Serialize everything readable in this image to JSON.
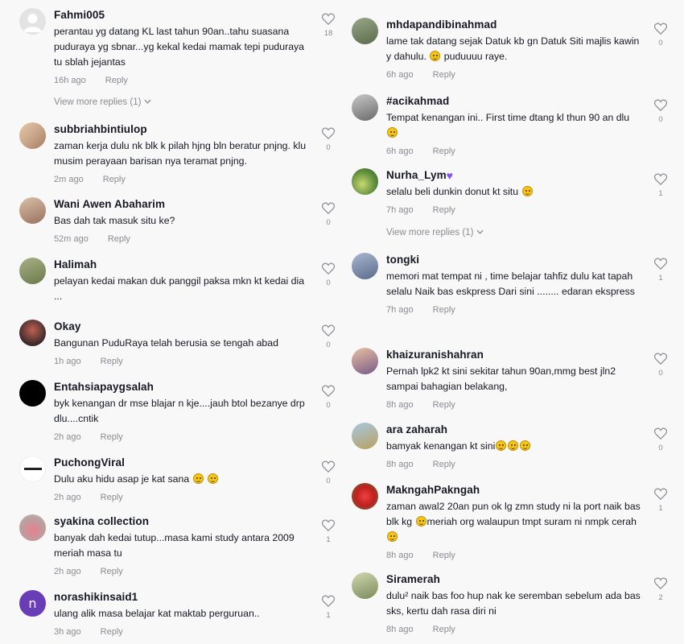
{
  "reply_label": "Reply",
  "left": [
    {
      "user": "Fahmi005",
      "text": "perantau yg datang KL last tahun 90an..tahu suasana puduraya yg sbnar...yg kekal kedai mamak tepi puduraya tu sblah jejantas",
      "time": "16h ago",
      "likes": "18",
      "avatar_color": "#d9d9d9",
      "avatar": "default-avatar",
      "view_more": "View more replies (1)"
    },
    {
      "user": "subbriahbintiulop",
      "text": "zaman kerja dulu nk blk k pilah hjng bln beratur pnjng. klu musim perayaan barisan nya teramat pnjng.",
      "time": "2m ago",
      "likes": "0",
      "avatar_color": "#c9a78a",
      "avatar": "photo-avatar"
    },
    {
      "user": "Wani Awen Abaharim",
      "text": "Bas dah tak masuk situ ke?",
      "time": "52m ago",
      "likes": "0",
      "avatar_color": "#b58a6e",
      "avatar": "photo-avatar"
    },
    {
      "user": "Halimah",
      "text": "pelayan kedai makan duk panggil paksa mkn kt kedai dia ...",
      "time": "",
      "likes": "0",
      "avatar_color": "#7a8a5a",
      "avatar": "photo-avatar"
    },
    {
      "user": "Okay",
      "text": "Bangunan PuduRaya telah berusia se tengah abad",
      "time": "1h ago",
      "likes": "0",
      "avatar_color": "#3a2a2a",
      "avatar": "photo-avatar"
    },
    {
      "user": "Entahsiapaygsalah",
      "text": "byk kenangan dr mse blajar n kje....jauh btol bezanye drp dlu....cntik",
      "time": "2h ago",
      "likes": "0",
      "avatar_color": "#000000",
      "avatar": "black-avatar"
    },
    {
      "user": "PuchongViral",
      "text": "Dulu aku hidu asap je kat sana",
      "time": "2h ago",
      "likes": "0",
      "avatar_color": "#ffffff",
      "avatar": "logo-avatar",
      "emojis": 2
    },
    {
      "user": "syakina collection",
      "text": "banyak dah kedai tutup...masa kami study antara 2009 meriah masa tu",
      "time": "2h ago",
      "likes": "1",
      "avatar_color": "#d96a7a",
      "avatar": "photo-avatar"
    },
    {
      "user": "norashikinsaid1",
      "text": "ulang alik masa belajar kat maktab perguruan..",
      "time": "3h ago",
      "likes": "1",
      "avatar_color": "#6a3db8",
      "avatar": "letter-avatar",
      "letter": "n"
    }
  ],
  "right": [
    {
      "user": "mhdapandibinahmad",
      "text": "lame tak datang sejak Datuk kb gn Datuk Siti majlis kawin y dahulu.",
      "text_after": " puduuuu raye.",
      "time": "6h ago",
      "likes": "0",
      "avatar_color": "#6b7a5a",
      "avatar": "photo-avatar",
      "emoji_mid": true
    },
    {
      "user": "#acikahmad",
      "text": "Tempat kenangan ini.. First time dtang kl thun 90 an dlu",
      "time": "6h ago",
      "likes": "0",
      "avatar_color": "#8a8a8a",
      "avatar": "photo-avatar",
      "emojis": 1
    },
    {
      "user": "Nurha_Lym",
      "user_heart": true,
      "text": "selalu beli dunkin donut kt situ",
      "time": "7h ago",
      "likes": "1",
      "avatar_color": "#7a9a5a",
      "avatar": "photo-avatar",
      "emojis": 1,
      "view_more": "View more replies (1)"
    },
    {
      "user": "tongki",
      "text": "memori mat tempat ni , time belajar tahfiz dulu kat tapah selalu Naik bas eskpress Dari sini ........ edaran ekspress",
      "time": "7h ago",
      "likes": "1",
      "avatar_color": "#5a6a8a",
      "avatar": "photo-avatar"
    },
    {
      "user": "khaizuranishahran",
      "text": "Pernah lpk2 kt sini sekitar tahun 90an,mmg best jln2 sampai bahagian belakang,",
      "time": "8h ago",
      "likes": "0",
      "avatar_color": "#9a7a8a",
      "avatar": "photo-avatar"
    },
    {
      "user": "ara zaharah",
      "text": "bamyak kenangan kt sini",
      "time": "8h ago",
      "likes": "0",
      "avatar_color": "#b8a060",
      "avatar": "photo-avatar",
      "emojis": 3
    },
    {
      "user": "MakngahPakngah",
      "text": "zaman awal2 20an pun ok lg zmn study ni la port naik bas blk kg",
      "text_after": "meriah org walaupun tmpt suram ni nmpk cerah",
      "time": "8h ago",
      "likes": "1",
      "avatar_color": "#c02020",
      "avatar": "photo-avatar",
      "emoji_mid": true,
      "emojis": 1
    },
    {
      "user": "Siramerah",
      "text": "dulu² naik bas foo hup nak ke seremban sebelum ada bas sks, kertu dah rasa diri ni",
      "time": "8h ago",
      "likes": "2",
      "avatar_color": "#8a9a6a",
      "avatar": "photo-avatar"
    }
  ],
  "top_partial": {
    "time": "6h ago",
    "reply": "Reply"
  }
}
